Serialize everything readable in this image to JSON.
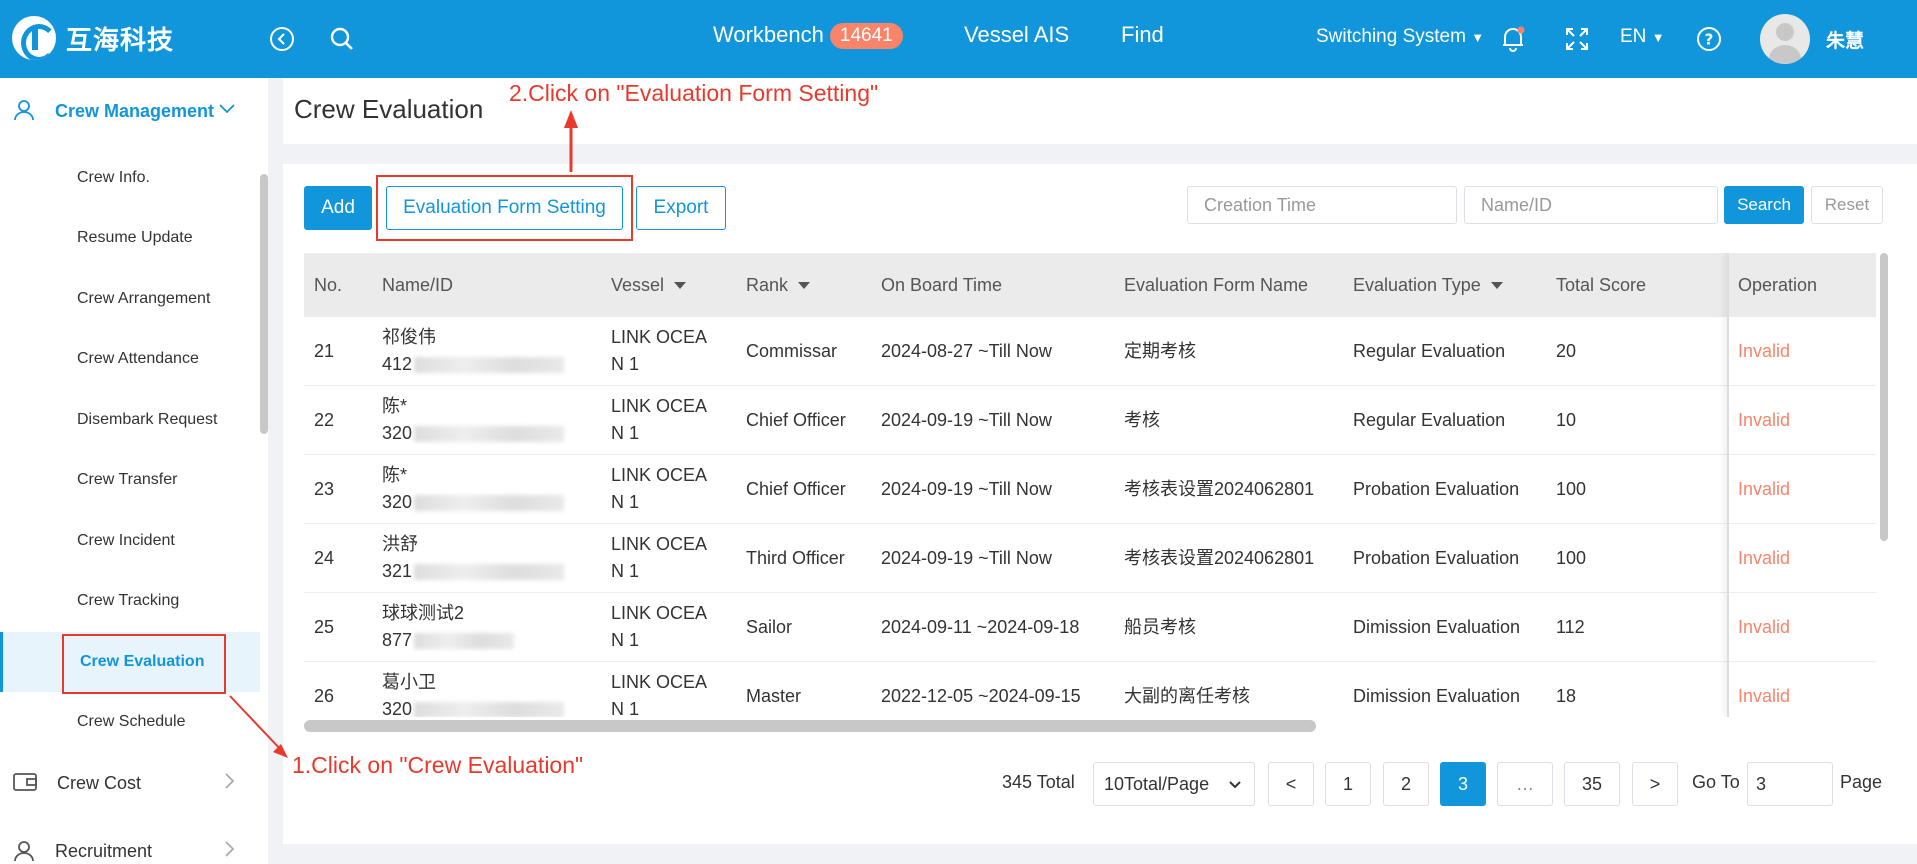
{
  "header": {
    "logo_text": "互海科技",
    "nav": [
      {
        "label": "Workbench",
        "badge": "14641"
      },
      {
        "label": "Vessel AIS"
      },
      {
        "label": "Find"
      }
    ],
    "switching_system": "Switching System",
    "language": "EN",
    "username": "朱慧"
  },
  "sidebar": {
    "group_crew_management": "Crew Management",
    "items": [
      {
        "label": "Crew Info."
      },
      {
        "label": "Resume Update"
      },
      {
        "label": "Crew Arrangement"
      },
      {
        "label": "Crew Attendance"
      },
      {
        "label": "Disembark Request"
      },
      {
        "label": "Crew Transfer"
      },
      {
        "label": "Crew Incident"
      },
      {
        "label": "Crew Tracking"
      },
      {
        "label": "Crew Evaluation"
      },
      {
        "label": "Crew Schedule"
      }
    ],
    "group_crew_cost": "Crew Cost",
    "group_recruitment": "Recruitment"
  },
  "page": {
    "title": "Crew Evaluation"
  },
  "toolbar": {
    "add_label": "Add",
    "evaluation_form_setting_label": "Evaluation Form Setting",
    "export_label": "Export",
    "creation_time_placeholder": "Creation Time",
    "name_id_placeholder": "Name/ID",
    "search_label": "Search",
    "reset_label": "Reset"
  },
  "table": {
    "columns": [
      {
        "label": "No."
      },
      {
        "label": "Name/ID"
      },
      {
        "label": "Vessel"
      },
      {
        "label": "Rank"
      },
      {
        "label": "On Board Time"
      },
      {
        "label": "Evaluation Form Name"
      },
      {
        "label": "Evaluation Type"
      },
      {
        "label": "Total Score"
      },
      {
        "label": "Operation"
      }
    ],
    "rows": [
      {
        "no": "21",
        "name": "祁俊伟",
        "id": "412",
        "vessel1": "LINK OCEA",
        "vessel2": "N 1",
        "rank": "Commissar",
        "onboard": "2024-08-27 ~Till Now",
        "form": "定期考核",
        "type": "Regular Evaluation",
        "score": "20",
        "op": "Invalid"
      },
      {
        "no": "22",
        "name": "陈*",
        "id": "320",
        "vessel1": "LINK OCEA",
        "vessel2": "N 1",
        "rank": "Chief Officer",
        "onboard": "2024-09-19 ~Till Now",
        "form": "考核",
        "type": "Regular Evaluation",
        "score": "10",
        "op": "Invalid"
      },
      {
        "no": "23",
        "name": "陈*",
        "id": "320",
        "vessel1": "LINK OCEA",
        "vessel2": "N 1",
        "rank": "Chief Officer",
        "onboard": "2024-09-19 ~Till Now",
        "form": "考核表设置2024062801",
        "type": "Probation Evaluation",
        "score": "100",
        "op": "Invalid"
      },
      {
        "no": "24",
        "name": "洪舒",
        "id": "321",
        "vessel1": "LINK OCEA",
        "vessel2": "N 1",
        "rank": "Third Officer",
        "onboard": "2024-09-19 ~Till Now",
        "form": "考核表设置2024062801",
        "type": "Probation Evaluation",
        "score": "100",
        "op": "Invalid"
      },
      {
        "no": "25",
        "name": "球球测试2",
        "id": "877",
        "vessel1": "LINK OCEA",
        "vessel2": "N 1",
        "rank": "Sailor",
        "onboard": "2024-09-11 ~2024-09-18",
        "form": "船员考核",
        "type": "Dimission Evaluation",
        "score": "112",
        "op": "Invalid"
      },
      {
        "no": "26",
        "name": "葛小卫",
        "id": "320",
        "vessel1": "LINK OCEA",
        "vessel2": "N 1",
        "rank": "Master",
        "onboard": "2022-12-05 ~2024-09-15",
        "form": "大副的离任考核",
        "type": "Dimission Evaluation",
        "score": "18",
        "op": "Invalid"
      }
    ]
  },
  "pagination": {
    "total": "345 Total",
    "page_size": "10Total/Page",
    "prev": "<",
    "pages": [
      "1",
      "2",
      "3",
      "…",
      "35"
    ],
    "current": "3",
    "next": ">",
    "goto_label": "Go To",
    "goto_value": "3",
    "page_label": "Page"
  },
  "annotations": {
    "step1": "1.Click on \"Crew Evaluation\"",
    "step2": "2.Click on \"Evaluation Form Setting\""
  },
  "colors": {
    "primary": "#1296db",
    "badge": "#f9846a",
    "invalid": "#f9846a",
    "annotation": "#e8392c"
  }
}
